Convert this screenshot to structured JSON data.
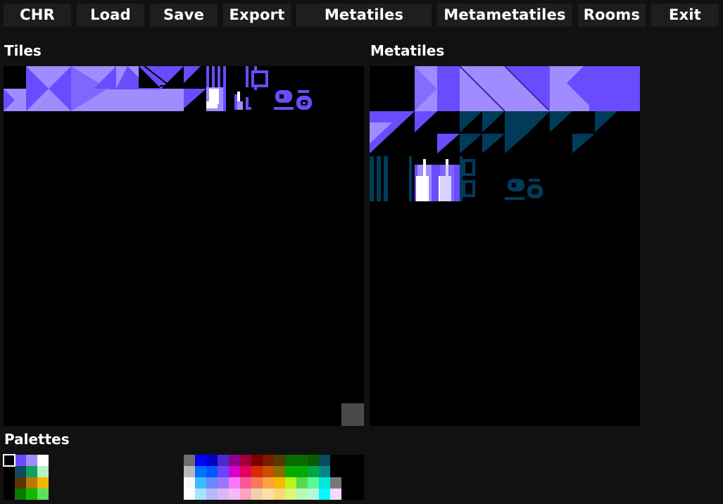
{
  "menu": [
    {
      "label": "CHR",
      "name": "chr-button"
    },
    {
      "label": "Load",
      "name": "load-button"
    },
    {
      "label": "Save",
      "name": "save-button"
    },
    {
      "label": "Export",
      "name": "export-button"
    },
    {
      "label": "Metatiles",
      "name": "metatiles-button"
    },
    {
      "label": "Metametatiles",
      "name": "metametatiles-button"
    },
    {
      "label": "Rooms",
      "name": "rooms-button"
    },
    {
      "label": "Exit",
      "name": "exit-button"
    }
  ],
  "tiles_panel": {
    "title": "Tiles"
  },
  "metatiles_panel": {
    "title": "Metatiles"
  },
  "palettes_panel": {
    "title": "Palettes"
  },
  "colors": {
    "background": "#111111",
    "button": "#1e1e1e",
    "canvas": "#000000",
    "purple_dark": "#6a4cff",
    "purple_light": "#a08cff",
    "teal": "#003c5a",
    "white": "#ffffff"
  },
  "palettes": [
    [
      "#000000",
      "#6a4cff",
      "#a08cff",
      "#ffffff"
    ],
    [
      "#000000",
      "#0f4a5e",
      "#13a05c",
      "#b8f2c4"
    ],
    [
      "#000000",
      "#5a3400",
      "#b87a00",
      "#f0b800"
    ],
    [
      "#000000",
      "#0a7a00",
      "#10b800",
      "#5ce05c"
    ]
  ],
  "master_palette": [
    [
      "#6e6e6e",
      "#0000ff",
      "#0000c8",
      "#4a2ac8",
      "#8e0090",
      "#a0003a",
      "#7a0000",
      "#7a1a00",
      "#523a00",
      "#0a6a00",
      "#0a6a00",
      "#0a5a00",
      "#0a4a5a",
      "#000000",
      "#000000",
      "#000000"
    ],
    [
      "#b8b8b8",
      "#0070ff",
      "#0058ff",
      "#6a44ff",
      "#d800cc",
      "#e4005a",
      "#d82a00",
      "#cc4c00",
      "#886e00",
      "#00ac00",
      "#00ac00",
      "#00a844",
      "#008888",
      "#000000",
      "#000000",
      "#000000"
    ],
    [
      "#f8f8f8",
      "#3cbcfc",
      "#6888fc",
      "#9878f8",
      "#f878f8",
      "#f85898",
      "#f87858",
      "#fca044",
      "#f8b800",
      "#b8f818",
      "#58d854",
      "#58f898",
      "#00e8d8",
      "#787878",
      "#000000",
      "#000000"
    ],
    [
      "#fcfcfc",
      "#a4e4fc",
      "#b8b8f8",
      "#d8b8f8",
      "#f8b8f8",
      "#f8a4c0",
      "#f0d0b0",
      "#fce0a8",
      "#f8d878",
      "#d8f878",
      "#b8f8b8",
      "#b8f8d8",
      "#00fcfc",
      "#f8d8f8",
      "#000000",
      "#000000"
    ]
  ]
}
